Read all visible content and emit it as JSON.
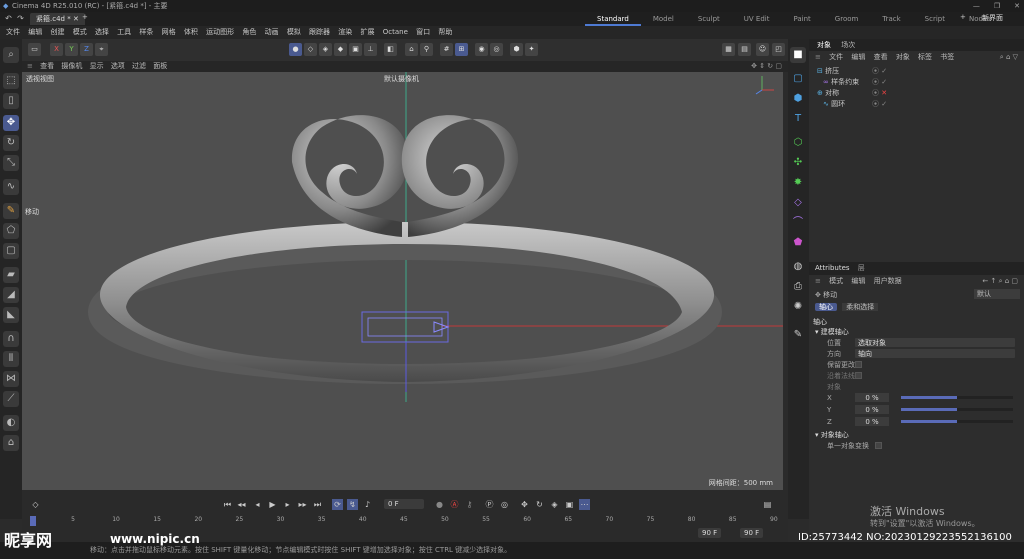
{
  "window": {
    "title": "Cinema 4D R25.010 (RC) - [紧箍.c4d *] - 主要"
  },
  "tabs": {
    "doc": "紧箍.c4d *",
    "add": "+"
  },
  "layouts": [
    "Standard",
    "Model",
    "Sculpt",
    "UV Edit",
    "Paint",
    "Groom",
    "Track",
    "Script",
    "Nodes"
  ],
  "layout_new": "新界面",
  "menubar": [
    "文件",
    "编辑",
    "创建",
    "模式",
    "选择",
    "工具",
    "样条",
    "网格",
    "体积",
    "运动图形",
    "角色",
    "动画",
    "模拟",
    "跟踪器",
    "渲染",
    "扩展",
    "Octane",
    "窗口",
    "帮助"
  ],
  "axes": {
    "x": "X",
    "y": "Y",
    "z": "Z"
  },
  "viewport_menu": [
    "查看",
    "摄像机",
    "显示",
    "选项",
    "过滤",
    "面板"
  ],
  "viewport": {
    "label": "透视视图",
    "camera": "默认摄像机",
    "grid_info": "网格间距：500 mm",
    "move_label": "移动"
  },
  "objects": {
    "tabs": [
      "对象",
      "场次"
    ],
    "menu": [
      "文件",
      "编辑",
      "查看",
      "对象",
      "标签",
      "书签"
    ],
    "rows": [
      {
        "name": "挤压"
      },
      {
        "name": "样条约束"
      },
      {
        "name": "对称"
      },
      {
        "name": "圆环"
      }
    ]
  },
  "attributes": {
    "tab": "Attributes",
    "tab2": "层",
    "menu": [
      "模式",
      "编辑",
      "用户数据"
    ],
    "tool": "移动",
    "preset": "默认",
    "subtabs": [
      "轴心",
      "柔和选择"
    ],
    "section": "轴心",
    "group1": "建模轴心",
    "position_label": "位置",
    "position_value": "选取对象",
    "direction_label": "方向",
    "direction_value": "轴向",
    "keep_changes": "保留更改",
    "along_normal": "沿着法线",
    "object_label": "对象",
    "sliders": [
      {
        "axis": "X",
        "value": "0 %",
        "fill": 0.5
      },
      {
        "axis": "Y",
        "value": "0 %",
        "fill": 0.5
      },
      {
        "axis": "Z",
        "value": "0 %",
        "fill": 0.5
      }
    ],
    "group2": "对象轴心",
    "single_transform": "单一对象变换"
  },
  "timeline": {
    "current_frame": "0 F",
    "end_frame": "90 F",
    "end_frame2": "90 F",
    "ticks": [
      "0",
      "5",
      "10",
      "15",
      "20",
      "25",
      "30",
      "35",
      "40",
      "45",
      "50",
      "55",
      "60",
      "65",
      "70",
      "75",
      "80",
      "85",
      "90"
    ]
  },
  "status": "移动：点击并拖动鼠标移动元素。按住 SHIFT 键量化移动；节点编辑模式时按住 SHIFT 键增加选择对象；按住 CTRL 键减少选择对象。",
  "watermark": {
    "line1": "激活 Windows",
    "line2": "转到\"设置\"以激活 Windows。"
  },
  "credit": "ID:25773442 NO:20230129223552136100",
  "logo": "昵享网",
  "logo_url": "www.nipic.cn"
}
